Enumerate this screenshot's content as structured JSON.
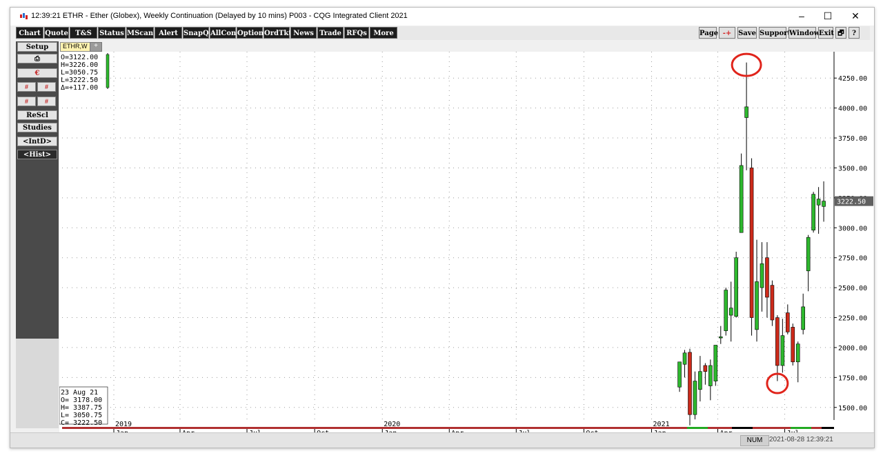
{
  "window": {
    "title": "12:39:21  ETHR - Ether (Globex), Weekly Continuation (Delayed by 10 mins)   P003 - CQG Integrated Client 2021",
    "controls": {
      "minimize": "–",
      "maximize": "☐",
      "close": "✕"
    }
  },
  "toolbar": {
    "left": [
      "Chart",
      "Quote",
      "T&S",
      "Status",
      "MScan",
      "Alert",
      "SnapQ",
      "AllCon",
      "Options",
      "OrdTkt",
      "News",
      "Trade",
      "RFQs",
      "More"
    ],
    "right": [
      "Page",
      "-+",
      "Save",
      "Support",
      "Window",
      "Exit",
      "🗗",
      "?"
    ]
  },
  "sidebar": {
    "setup": "Setup",
    "print_icon": "printer-icon",
    "currency_icon": "currency-icon",
    "rescale": "ReScl",
    "studies": "Studies",
    "intd": "<IntD>",
    "hist": "<Hist>"
  },
  "tabs": {
    "active": "ETHR,W",
    "add": "+"
  },
  "chart_data": {
    "type": "candlestick",
    "title": "",
    "colors": {
      "up": "#2eb82e",
      "down": "#cc2a1a",
      "wick": "#000000",
      "background": "#ffffff",
      "annotation": "#e0241b",
      "last_price_tag": "#606060"
    },
    "ohlc_readout_top": [
      "O=3122.00",
      "H=3226.00",
      "L=3050.75",
      "L=3222.50",
      "Δ=+117.00"
    ],
    "ohlc_readout_bottom": [
      "23 Aug 21",
      "O= 3178.00",
      "H= 3387.75",
      "L= 3050.75",
      "C= 3222.50"
    ],
    "y_axis": {
      "ticks": [
        1500,
        1750,
        2000,
        2250,
        2500,
        2750,
        3000,
        3250,
        3500,
        3750,
        4000,
        4250
      ],
      "tick_labels": [
        "1500.00",
        "1750.00",
        "2000.00",
        "2250.00",
        "2500.00",
        "2750.00",
        "3000.00",
        "3250.00",
        "3500.00",
        "3750.00",
        "4000.00",
        "4250.00"
      ],
      "range": [
        1395,
        4470
      ],
      "last_price_label": "3222.50",
      "last_price": 3222.5
    },
    "x_axis": {
      "year_labels": [
        "2019",
        "2020",
        "2021"
      ],
      "month_labels": [
        "Jan",
        "Apr",
        "Jul",
        "Oct",
        "Jan",
        "Apr",
        "Jul",
        "Oct",
        "Jan",
        "Apr",
        "Jul"
      ],
      "start": "2019-01-01",
      "end": "2021-09-06"
    },
    "grid": true,
    "legend": "none",
    "annotations": [
      {
        "type": "ellipse",
        "date": "2021-05-10",
        "value": 4360
      },
      {
        "type": "ellipse",
        "date": "2021-06-21",
        "value": 1700
      }
    ],
    "candles": [
      {
        "d": "2021-02-08",
        "o": 1670,
        "h": 1870,
        "l": 1630,
        "c": 1880
      },
      {
        "d": "2021-02-15",
        "o": 1860,
        "h": 1980,
        "l": 1750,
        "c": 1955
      },
      {
        "d": "2021-02-22",
        "o": 1960,
        "h": 1990,
        "l": 1350,
        "c": 1440
      },
      {
        "d": "2021-03-01",
        "o": 1440,
        "h": 1800,
        "l": 1400,
        "c": 1720
      },
      {
        "d": "2021-03-08",
        "o": 1650,
        "h": 1930,
        "l": 1550,
        "c": 1800
      },
      {
        "d": "2021-03-15",
        "o": 1850,
        "h": 1870,
        "l": 1690,
        "c": 1800
      },
      {
        "d": "2021-03-22",
        "o": 1680,
        "h": 1900,
        "l": 1560,
        "c": 1850
      },
      {
        "d": "2021-03-29",
        "o": 1720,
        "h": 2000,
        "l": 1680,
        "c": 2020
      },
      {
        "d": "2021-04-05",
        "o": 2080,
        "h": 2180,
        "l": 2030,
        "c": 2090
      },
      {
        "d": "2021-04-12",
        "o": 2140,
        "h": 2500,
        "l": 2100,
        "c": 2480
      },
      {
        "d": "2021-04-19",
        "o": 2270,
        "h": 2550,
        "l": 2050,
        "c": 2330
      },
      {
        "d": "2021-04-26",
        "o": 2260,
        "h": 2800,
        "l": 2250,
        "c": 2750
      },
      {
        "d": "2021-05-03",
        "o": 2960,
        "h": 3620,
        "l": 2980,
        "c": 3520
      },
      {
        "d": "2021-05-10",
        "o": 3920,
        "h": 4380,
        "l": 3480,
        "c": 4010
      },
      {
        "d": "2021-05-17",
        "o": 3500,
        "h": 3580,
        "l": 2100,
        "c": 2250
      },
      {
        "d": "2021-05-24",
        "o": 2150,
        "h": 2900,
        "l": 2050,
        "c": 2550
      },
      {
        "d": "2021-05-31",
        "o": 2500,
        "h": 2880,
        "l": 2300,
        "c": 2700
      },
      {
        "d": "2021-06-07",
        "o": 2750,
        "h": 2880,
        "l": 2250,
        "c": 2420
      },
      {
        "d": "2021-06-14",
        "o": 2520,
        "h": 2560,
        "l": 2180,
        "c": 2230
      },
      {
        "d": "2021-06-21",
        "o": 2250,
        "h": 2270,
        "l": 1720,
        "c": 1850
      },
      {
        "d": "2021-06-28",
        "o": 1850,
        "h": 2240,
        "l": 1790,
        "c": 2100
      },
      {
        "d": "2021-07-05",
        "o": 2290,
        "h": 2360,
        "l": 2110,
        "c": 2130
      },
      {
        "d": "2021-07-12",
        "o": 2170,
        "h": 2200,
        "l": 1850,
        "c": 1880
      },
      {
        "d": "2021-07-19",
        "o": 1880,
        "h": 2050,
        "l": 1710,
        "c": 2030
      },
      {
        "d": "2021-07-26",
        "o": 2150,
        "h": 2450,
        "l": 2110,
        "c": 2340
      },
      {
        "d": "2021-08-02",
        "o": 2640,
        "h": 2940,
        "l": 2470,
        "c": 2920
      },
      {
        "d": "2021-08-09",
        "o": 2980,
        "h": 3300,
        "l": 2960,
        "c": 3280
      },
      {
        "d": "2021-08-16",
        "o": 3190,
        "h": 3340,
        "l": 2950,
        "c": 3240
      },
      {
        "d": "2021-08-23",
        "o": 3178,
        "h": 3387.75,
        "l": 3050.75,
        "c": 3222.5
      }
    ]
  },
  "status": {
    "num": "NUM",
    "time": "2021-08-28 12:39:21"
  }
}
